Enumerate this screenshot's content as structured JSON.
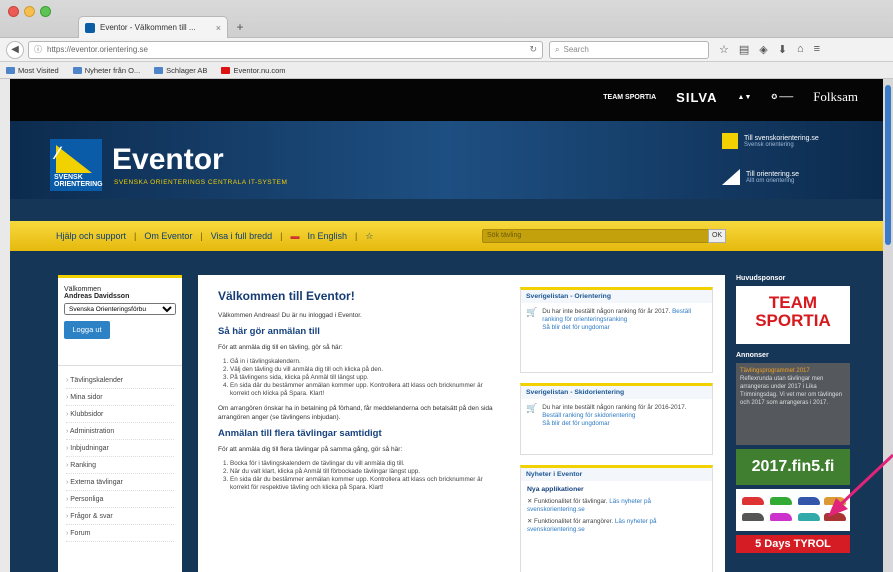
{
  "browser": {
    "tab_title": "Eventor - Välkommen till ...",
    "tab_close": "×",
    "new_tab": "+",
    "url": "https://eventor.orientering.se",
    "search_placeholder": "Search",
    "bookmarks": [
      "Most Visited",
      "Nyheter från O...",
      "Schlager AB",
      "Eventor.nu.com"
    ],
    "toolbar_icons": [
      "star-icon",
      "bookmarks-icon",
      "pocket-icon",
      "download-icon",
      "home-icon",
      "menu-icon"
    ]
  },
  "sponsors": [
    "TEAM SPORTIA",
    "SILVA",
    "Folksam"
  ],
  "header": {
    "logo_text": "SVENSK ORIENTERING",
    "title": "Eventor",
    "subtitle": "SVENSKA ORIENTERINGS CENTRALA IT-SYSTEM",
    "link1": "Till svenskorientering.se",
    "link1_sub": "Svensk orientering",
    "link2": "Till orientering.se",
    "link2_sub": "Allt om orientering"
  },
  "nav": {
    "items": [
      "Hjälp och support",
      "Om Eventor",
      "Visa i full bredd",
      "In English"
    ],
    "separator": "|",
    "search_placeholder": "Sök tävling",
    "search_button": "OK"
  },
  "login": {
    "welcome": "Välkommen",
    "user": "Andreas Davidsson",
    "club": "Svenska Orienteringsförbu",
    "logout": "Logga ut"
  },
  "leftnav": [
    "Tävlingskalender",
    "Mina sidor",
    "Klubbsidor",
    "Administration",
    "Inbjudningar",
    "Ranking",
    "Externa tävlingar",
    "Personliga",
    "Frågor & svar",
    "Forum"
  ],
  "main": {
    "title": "Välkommen till Eventor!",
    "intro": "Välkommen Andreas! Du är nu inloggad i Eventor.",
    "h_anmalan": "Så här gör anmälan till",
    "p_anmalan": "För att anmäla dig till en tävling, gör så här:",
    "steps1": [
      "Gå in i tävlingskalendern.",
      "Välj den tävling du vill anmäla dig till och klicka på den.",
      "På tävlingens sida, klicka på Anmäl till längst upp.",
      "En sida där du bestämmer anmälan kommer upp. Kontrollera att klass och bricknummer är korrekt och klicka på Spara. Klart!"
    ],
    "p_note": "Om arrangören önskar ha in betalning på förhand, får meddelanderna och betalsätt på den sida arrangören anger (se tävlingens inbjudan).",
    "h_flera": "Anmälan till flera tävlingar samtidigt",
    "p_flera": "För att anmäla dig till flera tävlingar på samma gång, gör så här:",
    "steps2": [
      "Bocka för i tävlingskalendern de tävlingar du vill anmäla dig till.",
      "När du valt klart, klicka på Anmäl till förbockade tävlingar längst upp.",
      "En sida där du bestämmer anmälan kommer upp. Kontrollera att klass och bricknummer är korrekt för respektive tävling och klicka på Spara. Klart!"
    ]
  },
  "boxes": {
    "b1_title": "Sverigelistan - Orientering",
    "b1_text": "Du har inte beställt någon ranking för år 2017.",
    "b1_link": "Beställ ranking för orienteringsranking",
    "b1_link2": "Så blir det för ungdomar",
    "b2_title": "Sverigelistan - Skidorientering",
    "b2_text": "Du har inte beställt någon ranking för år 2016-2017.",
    "b2_link": "Beställ ranking för skidorientering",
    "b2_link2": "Så blir det för ungdomar",
    "b3_title": "Nyheter i Eventor",
    "b3_sub": "Nya applikationer",
    "b3_item1": "Funktionalitet för tävlingar.",
    "b3_item1_link": "Läs nyheter på svenskorientering.se",
    "b3_item2": "Funktionalitet för arrangörer.",
    "b3_item2_link": "Läs nyheter på svenskorientering.se"
  },
  "rightcol": {
    "head_sponsor": "Huvudsponsor",
    "sportia_1": "TEAM",
    "sportia_2": "SPORTIA",
    "head_ads": "Annonser",
    "ad_grey_title": "Tävlingsprogrammet 2017",
    "ad_grey_text": "Reflexrunda utan tävlingar men arrangeras under 2017 i Lika Trimningsdag. Vi vet mer om tävlingen och 2017 som arrangeras i 2017.",
    "ad_green": "2017.fin5.fi",
    "ad_tyrol": "5 Days TYROL"
  },
  "colors": {
    "accent_yellow": "#f2d100",
    "header_blue": "#163657",
    "arrow_pink": "#e0247a"
  }
}
